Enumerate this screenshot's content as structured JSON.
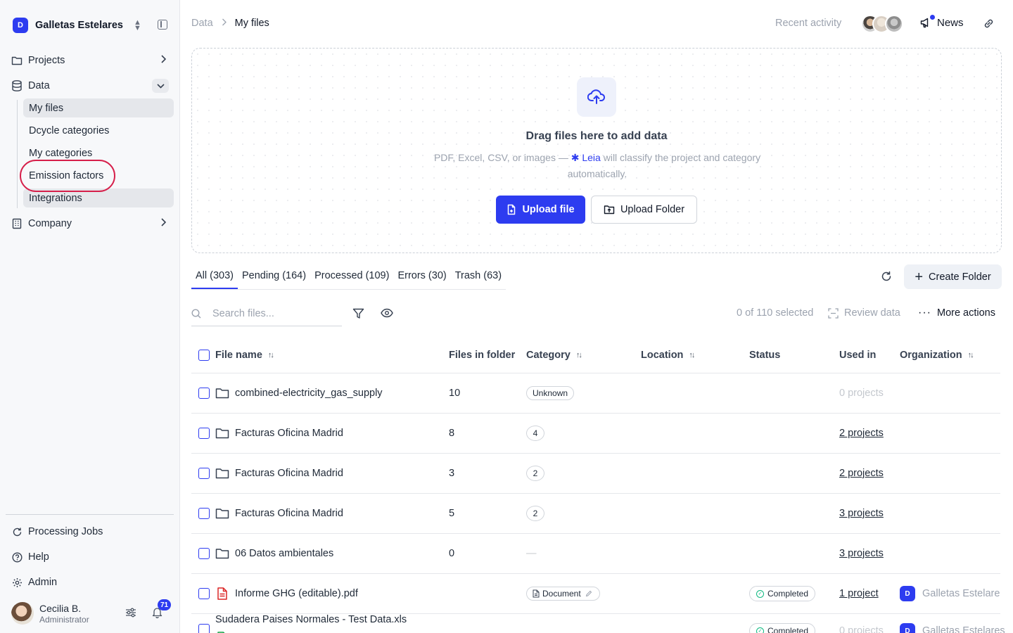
{
  "sidebar": {
    "org_name": "Galletas Estelares",
    "org_logo": "D",
    "nav": {
      "projects": "Projects",
      "data": "Data",
      "company": "Company"
    },
    "data_sub": [
      "My files",
      "Dcycle categories",
      "My categories",
      "Emission factors",
      "Integrations"
    ],
    "bottom": {
      "processing_jobs": "Processing Jobs",
      "help": "Help",
      "admin": "Admin"
    },
    "user": {
      "name": "Cecilia B.",
      "role": "Administrator",
      "notifications": "71"
    }
  },
  "header": {
    "breadcrumb": [
      "Data",
      "My files"
    ],
    "recent_activity": "Recent activity",
    "news": "News"
  },
  "dropzone": {
    "title": "Drag files here to add data",
    "subtitle_before": "PDF, Excel, CSV, or images — ",
    "leia": "Leia",
    "subtitle_after": " will classify the project and category automatically.",
    "upload_file": "Upload file",
    "upload_folder": "Upload Folder"
  },
  "tabs": [
    {
      "label": "All",
      "count": "(303)"
    },
    {
      "label": "Pending",
      "count": "(164)"
    },
    {
      "label": "Processed",
      "count": "(109)"
    },
    {
      "label": "Errors",
      "count": "(30)"
    },
    {
      "label": "Trash",
      "count": "(63)"
    }
  ],
  "create_folder": "Create Folder",
  "toolbar": {
    "search_placeholder": "Search files...",
    "selected": "0 of 110 selected",
    "review": "Review data",
    "more": "More actions"
  },
  "table": {
    "headers": {
      "file_name": "File name",
      "files_in_folder": "Files in folder",
      "category": "Category",
      "location": "Location",
      "status": "Status",
      "used_in": "Used in",
      "organization": "Organization"
    },
    "rows": [
      {
        "name": "combined-electricity_gas_supply",
        "count": "10",
        "category": "Unknown",
        "status": "",
        "used_in": "0 projects",
        "org": ""
      },
      {
        "name": "Facturas Oficina Madrid",
        "count": "8",
        "category": "4",
        "status": "",
        "used_in": "2 projects",
        "org": ""
      },
      {
        "name": "Facturas Oficina Madrid",
        "count": "3",
        "category": "2",
        "status": "",
        "used_in": "2 projects",
        "org": ""
      },
      {
        "name": "Facturas Oficina Madrid",
        "count": "5",
        "category": "2",
        "status": "",
        "used_in": "3 projects",
        "org": ""
      },
      {
        "name": "06 Datos ambientales",
        "count": "0",
        "category": "—",
        "status": "",
        "used_in": "3 projects",
        "org": ""
      },
      {
        "name": "Informe GHG (editable).pdf",
        "count": "",
        "category": "Document",
        "status": "Completed",
        "used_in": "1 project",
        "org": "Galletas Estelare"
      },
      {
        "name": "Sudadera Paises Normales - Test Data.xls",
        "count": "",
        "category": "",
        "status": "Completed",
        "used_in": "0 projects",
        "org": "Galletas Estelares"
      }
    ]
  },
  "colors": {
    "accent": "#2d3cf0",
    "highlight_ring": "#d61f4a",
    "success": "#10b981"
  }
}
